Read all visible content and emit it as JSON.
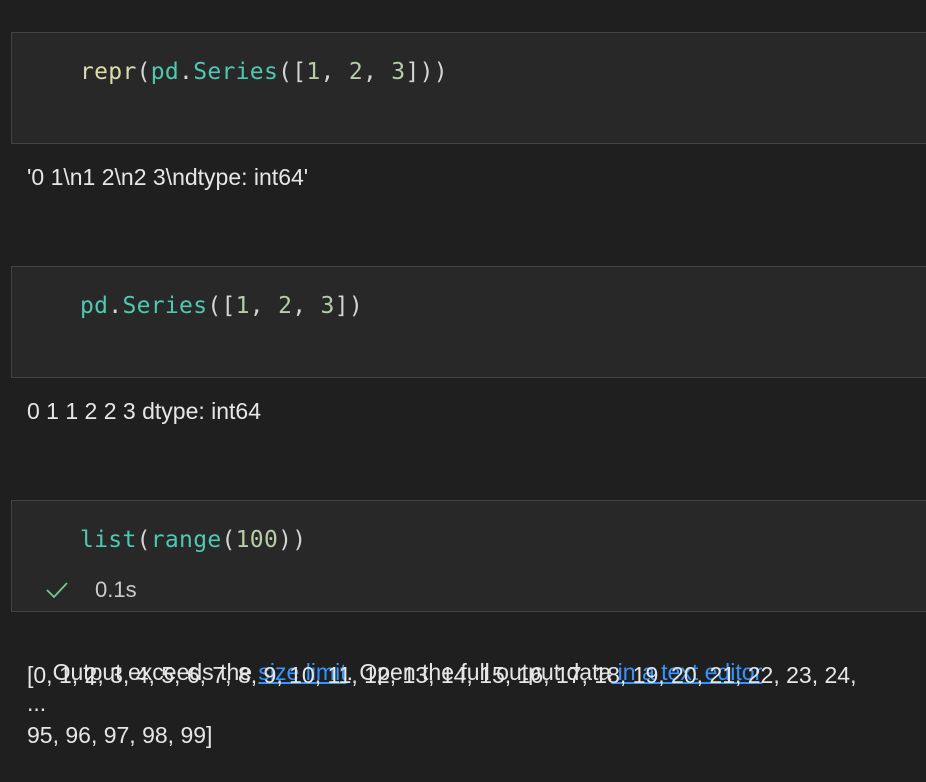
{
  "cells": [
    {
      "code_tokens": [
        {
          "text": "repr",
          "kind": "fn"
        },
        {
          "text": "(",
          "kind": "punc"
        },
        {
          "text": "pd",
          "kind": "var"
        },
        {
          "text": ".",
          "kind": "punc"
        },
        {
          "text": "Series",
          "kind": "var"
        },
        {
          "text": "([",
          "kind": "punc"
        },
        {
          "text": "1",
          "kind": "num"
        },
        {
          "text": ", ",
          "kind": "punc"
        },
        {
          "text": "2",
          "kind": "num"
        },
        {
          "text": ", ",
          "kind": "punc"
        },
        {
          "text": "3",
          "kind": "num"
        },
        {
          "text": "]))",
          "kind": "punc"
        }
      ],
      "output": "'0 1\\n1 2\\n2 3\\ndtype: int64'"
    },
    {
      "code_tokens": [
        {
          "text": "pd",
          "kind": "var"
        },
        {
          "text": ".",
          "kind": "punc"
        },
        {
          "text": "Series",
          "kind": "var"
        },
        {
          "text": "([",
          "kind": "punc"
        },
        {
          "text": "1",
          "kind": "num"
        },
        {
          "text": ", ",
          "kind": "punc"
        },
        {
          "text": "2",
          "kind": "num"
        },
        {
          "text": ", ",
          "kind": "punc"
        },
        {
          "text": "3",
          "kind": "num"
        },
        {
          "text": "])",
          "kind": "punc"
        }
      ],
      "output": "0 1 1 2 2 3 dtype: int64"
    },
    {
      "code_tokens": [
        {
          "text": "list",
          "kind": "var"
        },
        {
          "text": "(",
          "kind": "punc"
        },
        {
          "text": "range",
          "kind": "var"
        },
        {
          "text": "(",
          "kind": "punc"
        },
        {
          "text": "100",
          "kind": "num"
        },
        {
          "text": "))",
          "kind": "punc"
        }
      ],
      "status": {
        "duration": "0.1s",
        "icon": "check-icon",
        "color": "#73c991"
      },
      "output_notice": {
        "prefix": "Output exceeds the ",
        "link1": "size limit",
        "middle": ". Open the full output data",
        "link2": " in a text editor"
      },
      "output_lines": [
        "[0, 1, 2, 3, 4, 5, 6, 7, 8, 9, 10, 11, 12, 13, 14, 15, 16, 17, 18, 19, 20, 21, 22, 23, 24,",
        "...",
        "95, 96, 97, 98, 99]"
      ]
    }
  ],
  "colors": {
    "background": "#1f1f1f",
    "editor_bg": "#282828",
    "link": "#3794ff"
  }
}
